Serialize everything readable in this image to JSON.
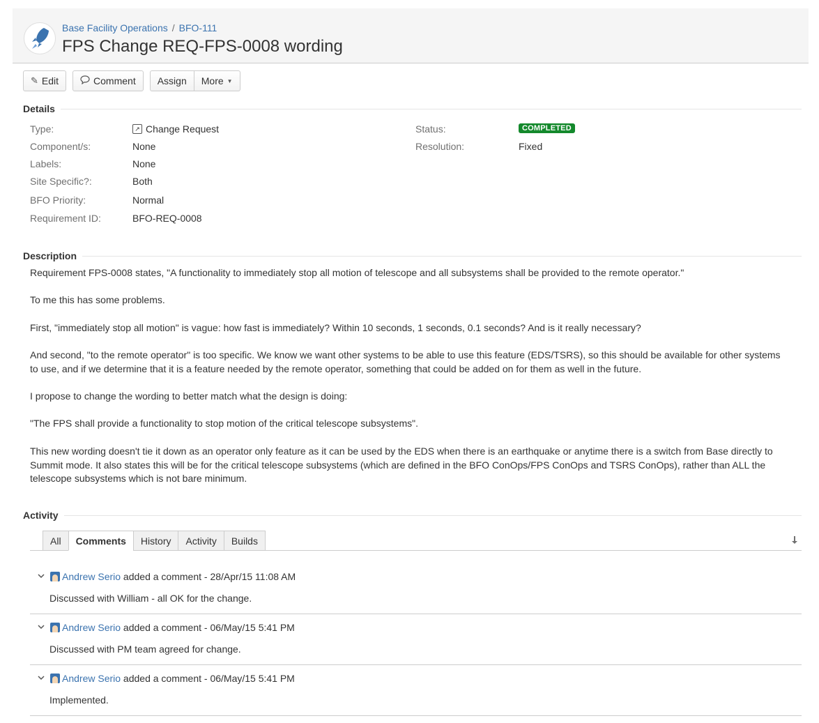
{
  "breadcrumb": {
    "project": "Base Facility Operations",
    "separator": "/",
    "issue_key": "BFO-111"
  },
  "title": "FPS Change REQ-FPS-0008 wording",
  "toolbar": {
    "edit": "Edit",
    "comment": "Comment",
    "assign": "Assign",
    "more": "More"
  },
  "details": {
    "heading": "Details",
    "left": [
      {
        "label": "Type:",
        "value": "Change Request"
      },
      {
        "label": "Component/s:",
        "value": "None"
      },
      {
        "label": "Labels:",
        "value": "None"
      },
      {
        "label": "Site Specific?:",
        "value": "Both"
      },
      {
        "label": "BFO Priority:",
        "value": "Normal"
      },
      {
        "label": "Requirement ID:",
        "value": "BFO-REQ-0008"
      }
    ],
    "status_label": "Status:",
    "status_value": "COMPLETED",
    "resolution_label": "Resolution:",
    "resolution_value": "Fixed",
    "status_color": "#14892c"
  },
  "description": {
    "heading": "Description",
    "paragraphs": [
      "Requirement FPS-0008 states, \"A functionality to immediately stop all motion of telescope and all subsystems shall be provided to the remote operator.\"",
      "To me this has some problems.",
      "First, \"immediately stop all motion\" is vague: how fast is immediately? Within 10 seconds, 1 seconds, 0.1 seconds? And is it really necessary?",
      "And second, \"to the remote operator\" is too specific. We know we want other systems to be able to use this feature (EDS/TSRS), so this should be available for other systems to use, and if we determine that it is a feature needed by the remote operator, something that could be added on for them as well in the future.",
      "I propose to change the wording to better match what the design is doing:",
      "\"The FPS shall provide a functionality to stop motion of the critical telescope subsystems\".",
      "This new wording doesn't tie it down as an operator only feature as it can be used by the EDS when there is an earthquake or anytime there is a switch from Base directly to Summit mode. It also states this will be for the critical telescope subsystems (which are defined in the BFO ConOps/FPS ConOps and TSRS ConOps), rather than ALL the telescope subsystems which is not bare minimum."
    ]
  },
  "activity": {
    "heading": "Activity",
    "tabs": [
      "All",
      "Comments",
      "History",
      "Activity",
      "Builds"
    ],
    "active_tab": "Comments",
    "comments": [
      {
        "author": "Andrew Serio",
        "meta": " added a comment - 28/Apr/15 11:08 AM",
        "body": "Discussed with William - all OK for the change."
      },
      {
        "author": "Andrew Serio",
        "meta": " added a comment - 06/May/15 5:41 PM",
        "body": "Discussed with PM team agreed for change."
      },
      {
        "author": "Andrew Serio",
        "meta": " added a comment - 06/May/15 5:41 PM",
        "body": "Implemented."
      }
    ]
  },
  "colors": {
    "link": "#3b73af",
    "label": "#707070"
  },
  "icons": {
    "project": "rocket-icon",
    "edit": "pencil-icon",
    "comment": "speech-bubble-icon",
    "type": "change-request-icon",
    "user": "user-avatar-icon",
    "sort": "sort-arrow-icon",
    "toggle": "chevron-down-icon"
  }
}
